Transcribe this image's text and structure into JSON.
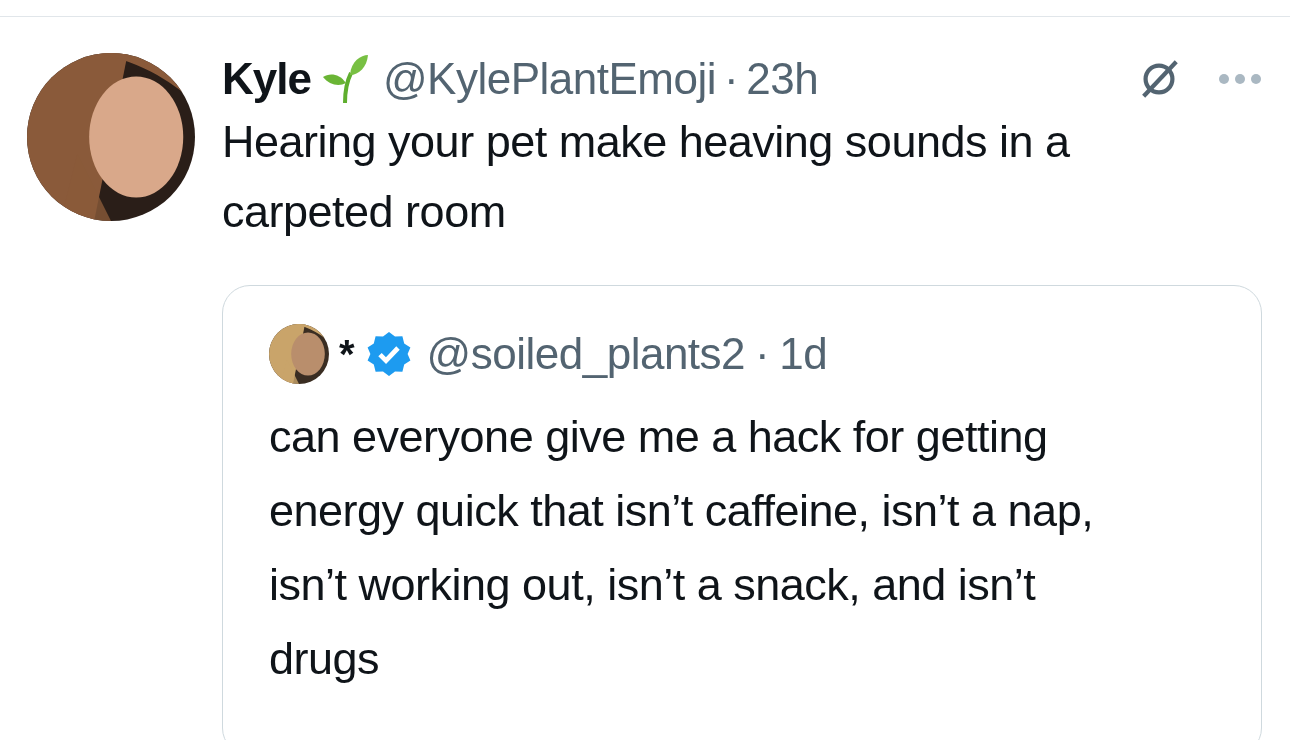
{
  "tweet": {
    "author": {
      "name": "Kyle",
      "handle": "@KylePlantEmoji",
      "separator": "·",
      "time": "23h"
    },
    "text": "Hearing your pet make heaving sounds in a carpeted room",
    "quote": {
      "author": {
        "name": "*",
        "verified": true,
        "handle": "@soiled_plants2",
        "separator": "·",
        "time": "1d"
      },
      "text": "can everyone give me a hack for getting energy quick that isn’t caffeine, isn’t a nap, isn’t working out, isn’t a snack, and isn’t drugs"
    }
  }
}
